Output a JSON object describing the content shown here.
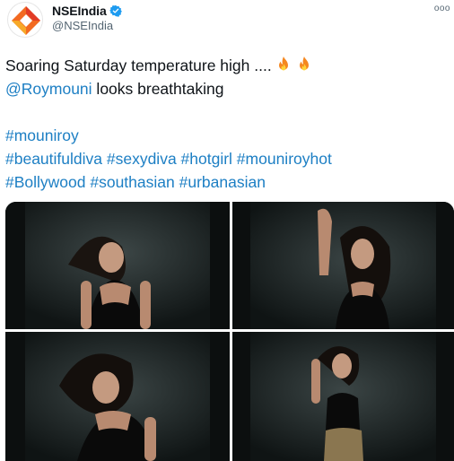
{
  "account": {
    "display_name": "NSEIndia",
    "handle": "@NSEIndia",
    "verified": true,
    "avatar_icon": "nse-logo-icon"
  },
  "tweet": {
    "line1": "Soaring Saturday temperature high ....",
    "line1_emoji": [
      "fire-emoji",
      "fire-emoji"
    ],
    "mention": "@Roymouni",
    "line2_rest": " looks breathtaking",
    "hashtags_line1": "#mouniroy",
    "hashtags_line2": "#beautifuldiva #sexydiva #hotgirl #mouniroyhot",
    "hashtags_line3": "#Bollywood #southasian #urbanasian"
  },
  "media": {
    "count": 4,
    "photos": [
      "photo-1",
      "photo-2",
      "photo-3",
      "photo-4"
    ]
  },
  "colors": {
    "link": "#1d7fc4",
    "text": "#0f1419",
    "secondary": "#536471",
    "verified": "#1d9bf0",
    "photo_bg": "#141a1a"
  }
}
